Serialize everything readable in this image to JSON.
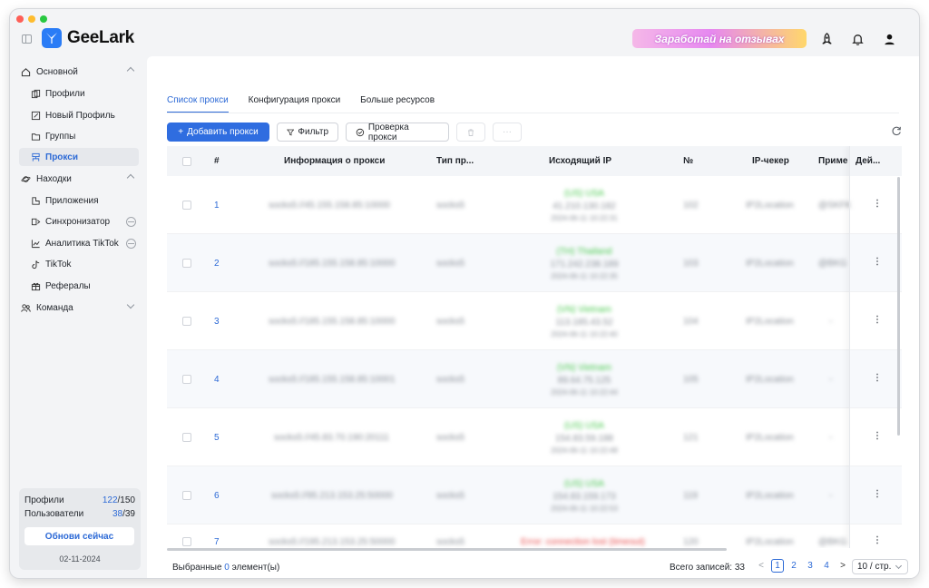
{
  "app": {
    "name": "GeeLark"
  },
  "header": {
    "promo_label": "Заработай на отзывах"
  },
  "sidebar": {
    "groups": [
      {
        "label": "Основной"
      },
      {
        "label": "Находки"
      },
      {
        "label": "Команда"
      }
    ],
    "main_items": [
      {
        "label": "Профили"
      },
      {
        "label": "Новый Профиль"
      },
      {
        "label": "Группы"
      },
      {
        "label": "Прокси"
      }
    ],
    "finds_items": [
      {
        "label": "Приложения"
      },
      {
        "label": "Синхронизатор"
      },
      {
        "label": "Аналитика TikTok"
      },
      {
        "label": "TikTok"
      },
      {
        "label": "Рефералы"
      }
    ],
    "quota": {
      "profiles_label": "Профили",
      "profiles_used": "122",
      "profiles_total": "/150",
      "users_label": "Пользователи",
      "users_used": "38",
      "users_total": "/39",
      "update_label": "Обнови сейчас",
      "date": "02-11-2024"
    }
  },
  "tabs": [
    {
      "label": "Список прокси"
    },
    {
      "label": "Конфигурация прокси"
    },
    {
      "label": "Больше ресурсов"
    }
  ],
  "toolbar": {
    "add_label": "Добавить прокси",
    "filter_label": "Фильтр",
    "check_label": "Проверка прокси",
    "more_label": "···"
  },
  "table": {
    "columns": [
      "#",
      "Информация о прокси",
      "Тип пр...",
      "Исходящий IP",
      "№",
      "IP-чекер",
      "Приме",
      "Дей..."
    ],
    "rows": [
      {
        "num": "1",
        "info": "socks5://45.155.158.85:10000",
        "type": "socks5",
        "ip_status": "(US) USA",
        "ip": "41.210.130.182",
        "ip_time": "2024-06-11 10:22:31",
        "no": "102",
        "checker": "IP2Location",
        "note": "@SKFK"
      },
      {
        "num": "2",
        "info": "socks5://185.155.158.85:10000",
        "type": "socks5",
        "ip_status": "(TH) Thailand",
        "ip": "171.242.238.189",
        "ip_time": "2024-06-11 10:22:35",
        "no": "103",
        "checker": "IP2Location",
        "note": "@BKG"
      },
      {
        "num": "3",
        "info": "socks5://185.155.158.85:10000",
        "type": "socks5",
        "ip_status": "(VN) Vietnam",
        "ip": "113.185.43.52",
        "ip_time": "2024-06-11 10:22:40",
        "no": "104",
        "checker": "IP2Location",
        "note": "-"
      },
      {
        "num": "4",
        "info": "socks5://185.155.158.85:10001",
        "type": "socks5",
        "ip_status": "(VN) Vietnam",
        "ip": "89.64.75.125",
        "ip_time": "2024-06-11 10:22:44",
        "no": "105",
        "checker": "IP2Location",
        "note": "-"
      },
      {
        "num": "5",
        "info": "socks5://45.83.70.190:20111",
        "type": "socks5",
        "ip_status": "(US) USA",
        "ip": "154.83.59.188",
        "ip_time": "2024-06-11 10:22:48",
        "no": "121",
        "checker": "IP2Location",
        "note": "-"
      },
      {
        "num": "6",
        "info": "socks5://95.213.153.25:50000",
        "type": "socks5",
        "ip_status": "(US) USA",
        "ip": "154.83.159.173",
        "ip_time": "2024-06-11 10:22:53",
        "no": "119",
        "checker": "IP2Location",
        "note": "-"
      },
      {
        "num": "7",
        "info": "socks5://195.213.153.25:50000",
        "type": "socks5",
        "ip_status": "Error: connection lost (timeout)",
        "ip": "",
        "ip_time": "",
        "no": "120",
        "checker": "IP2Location",
        "note": "@BKG"
      }
    ]
  },
  "footer": {
    "selected_prefix": "Выбранные ",
    "selected_count": "0",
    "selected_suffix": " элемент(ы)",
    "total_label": "Всего записей: 33",
    "pages": [
      "1",
      "2",
      "3",
      "4"
    ],
    "prev": "<",
    "next": ">",
    "per_page": "10 / стр."
  },
  "icons": {
    "sidebar_toggle": "sidebar-toggle-icon",
    "rocket": "rocket-icon",
    "bell": "bell-icon",
    "user": "user-icon",
    "refresh": "refresh-icon"
  },
  "colors": {
    "accent": "#2d6ad6",
    "primary_button": "#2f6de0",
    "success": "#47c94c",
    "error": "#e84a4a"
  }
}
